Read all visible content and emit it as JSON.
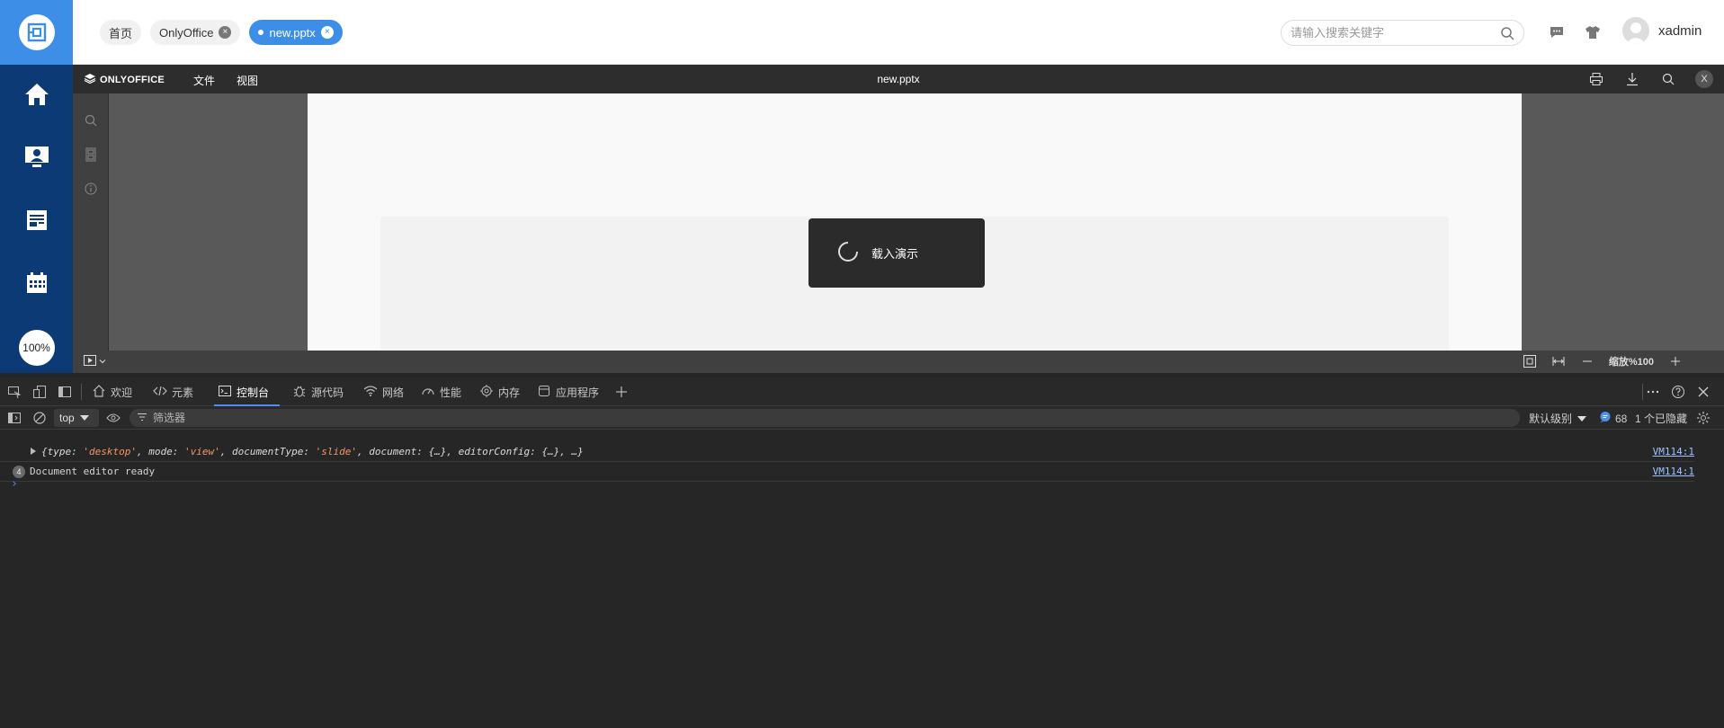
{
  "sidebar": {
    "zoom": "100%",
    "items": [
      "home-icon",
      "monitor-user-icon",
      "news-icon",
      "calendar-icon"
    ]
  },
  "header": {
    "tabs": [
      {
        "label": "首页"
      },
      {
        "label": "OnlyOffice"
      },
      {
        "label": "new.pptx"
      }
    ],
    "search_placeholder": "请输入搜索关键字",
    "username": "xadmin"
  },
  "editor": {
    "logo": "ONLYOFFICE",
    "menu": [
      "文件",
      "视图"
    ],
    "title": "new.pptx",
    "close": "X",
    "loading_text": "载入演示",
    "zoom_label": "缩放%100"
  },
  "devtools": {
    "tabs": [
      "欢迎",
      "元素",
      "控制台",
      "源代码",
      "网络",
      "性能",
      "内存",
      "应用程序"
    ],
    "active_tab": "控制台",
    "context": "top",
    "filter_placeholder": "筛选器",
    "levels": "默认级别",
    "message_count": "68",
    "hidden_count": "1 个已隐藏",
    "logs": [
      {
        "type": "object",
        "k1": "{type: ",
        "v1": "'desktop'",
        "k2": ", mode: ",
        "v2": "'view'",
        "k3": ", documentType: ",
        "v3": "'slide'",
        "rest": ", document: {…}, editorConfig: {…}, …}",
        "source": "VM114:1"
      },
      {
        "type": "text",
        "count": "4",
        "text": "Document editor ready",
        "source": "VM114:1"
      }
    ]
  },
  "colors": {
    "accent": "#3d8ee6",
    "sidebar": "#0b3a74",
    "devtools_bg": "#262626"
  }
}
